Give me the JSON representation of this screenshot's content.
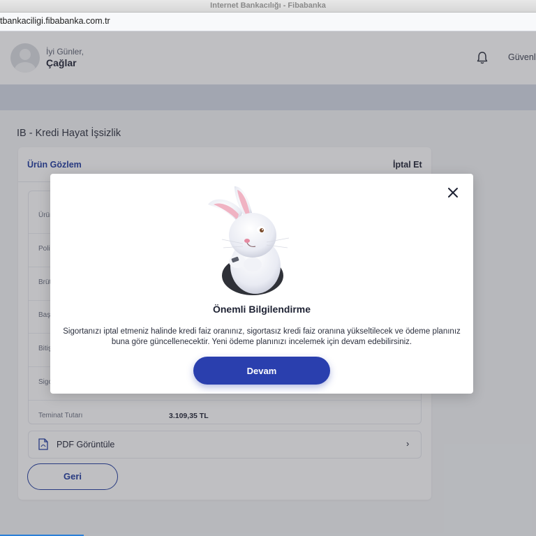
{
  "browser": {
    "window_title": "Internet Bankacılığı - Fibabanka",
    "url": "tbankaciligi.fibabanka.com.tr"
  },
  "header": {
    "greeting": "İyi Günler,",
    "user_name": "Çağlar",
    "security_label": "Güvenli"
  },
  "page": {
    "title": "IB - Kredi Hayat İşsizlik",
    "tab_label": "Ürün Gözlem",
    "cancel_label": "İptal Et",
    "rows": [
      {
        "label": "Ürün",
        "value": ""
      },
      {
        "label": "Poliç",
        "value": ""
      },
      {
        "label": "Brüt",
        "value": ""
      },
      {
        "label": "Başla",
        "value": ""
      },
      {
        "label": "Bitiş",
        "value": ""
      },
      {
        "label": "Sigor",
        "value": ""
      },
      {
        "label": "Teminat Tutarı",
        "value": "3.109,35 TL"
      }
    ],
    "pdf_label": "PDF Görüntüle",
    "back_label": "Geri"
  },
  "modal": {
    "title": "Önemli Bilgilendirme",
    "message": "Sigortanızı iptal etmeniz halinde kredi faiz oranınız, sigortasız kredi faiz oranına yükseltilecek ve ödeme planınız buna göre güncellenecektir. Yeni ödeme planınızı incelemek için devam edebilirsiniz.",
    "continue_label": "Devam"
  },
  "colors": {
    "brand_blue": "#2a3fae",
    "link_blue": "#1e3a9e",
    "band": "#d4dae6"
  }
}
